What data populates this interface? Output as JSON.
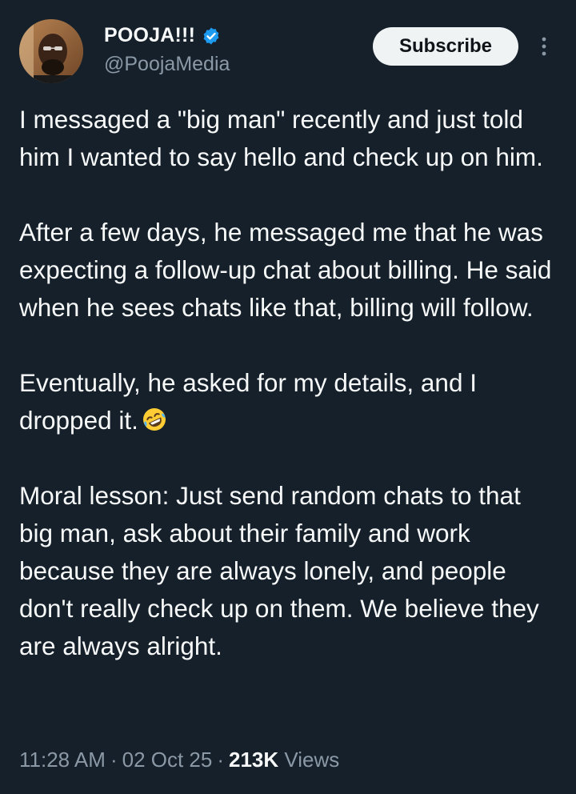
{
  "author": {
    "display_name": "POOJA!!!",
    "handle": "@PoojaMedia",
    "verified": true,
    "verified_icon": "verified-badge-icon",
    "avatar_icon": "avatar"
  },
  "actions": {
    "subscribe_label": "Subscribe",
    "more_icon": "more-vertical-icon"
  },
  "tweet": {
    "paragraphs": [
      "I messaged a \"big man\" recently and just told him I wanted to say hello and check up on him.",
      "After a few days, he messaged me that he was expecting a follow-up chat about billing. He said when he sees chats like that, billing will follow.",
      "Eventually, he asked for my details, and I dropped it.",
      "Moral lesson: Just send random chats to that big man, ask about their family and work because they are always lonely, and people don't really check up on them. We believe they are always alright."
    ],
    "emoji": "rolling-on-floor-laughing-emoji"
  },
  "meta": {
    "time": "11:28 AM",
    "date": "02 Oct 25",
    "views_count": "213K",
    "views_label": "Views",
    "separator": "·"
  },
  "colors": {
    "background": "#15202b",
    "text_primary": "#f7f9f9",
    "text_secondary": "#8b98a5",
    "verified_blue": "#1d9bf0",
    "button_bg": "#eff3f4",
    "button_text": "#0f1419"
  }
}
